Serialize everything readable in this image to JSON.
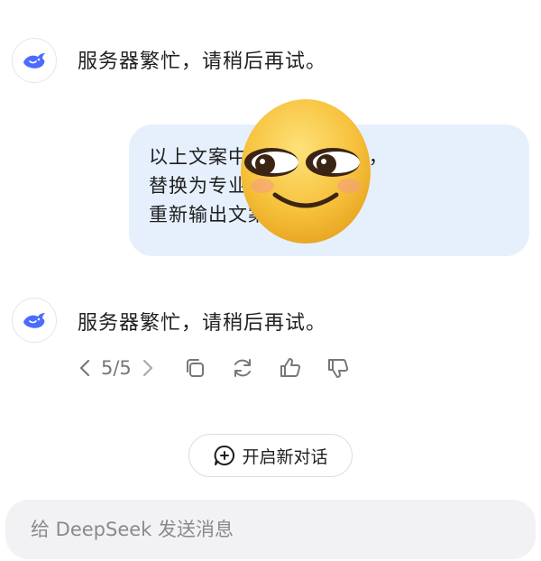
{
  "messages": [
    {
      "role": "assistant",
      "text": "服务器繁忙，请稍后再试。"
    },
    {
      "role": "user",
      "lines": [
        "以上文案中“推荐”的文字，",
        "替换为专业的推荐理由，",
        "重新输出文案"
      ]
    },
    {
      "role": "assistant",
      "text": "服务器繁忙，请稍后再试。"
    }
  ],
  "pager": {
    "text": "5/5"
  },
  "actions": [
    "copy-icon",
    "regenerate-icon",
    "thumbs-up-icon",
    "thumbs-down-icon"
  ],
  "new_chat": {
    "label": "开启新对话"
  },
  "composer": {
    "placeholder": "给 DeepSeek 发送消息"
  },
  "colors": {
    "accent": "#4d6bfe",
    "bubble": "#e6f0fd",
    "emoji": "#f7c23d"
  }
}
